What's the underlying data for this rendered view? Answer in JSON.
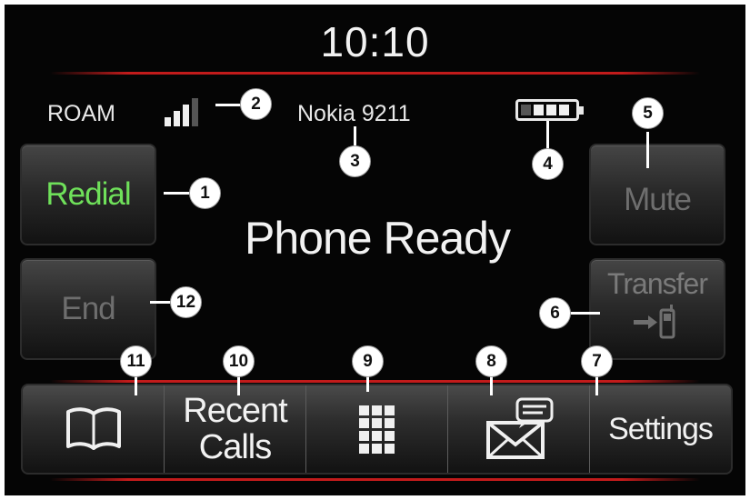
{
  "status": {
    "time": "10:10",
    "roam": "ROAM",
    "device_name": "Nokia 9211",
    "signal_bars": 3,
    "signal_bars_max": 4,
    "battery_cells": 3,
    "battery_cells_max": 4,
    "message": "Phone Ready"
  },
  "buttons": {
    "redial": "Redial",
    "end": "End",
    "mute": "Mute",
    "transfer": "Transfer"
  },
  "bottom_bar": {
    "phonebook_icon": "book-icon",
    "recent_line1": "Recent",
    "recent_line2": "Calls",
    "keypad_icon": "keypad-icon",
    "messaging_icon": "envelope-message-icon",
    "settings": "Settings"
  },
  "callouts": [
    "1",
    "2",
    "3",
    "4",
    "5",
    "6",
    "7",
    "8",
    "9",
    "10",
    "11",
    "12"
  ],
  "colors": {
    "accent_red": "#c21b1b",
    "redial_green": "#6fe05a",
    "disabled_gray": "#6e6e6e",
    "background": "#050505"
  }
}
